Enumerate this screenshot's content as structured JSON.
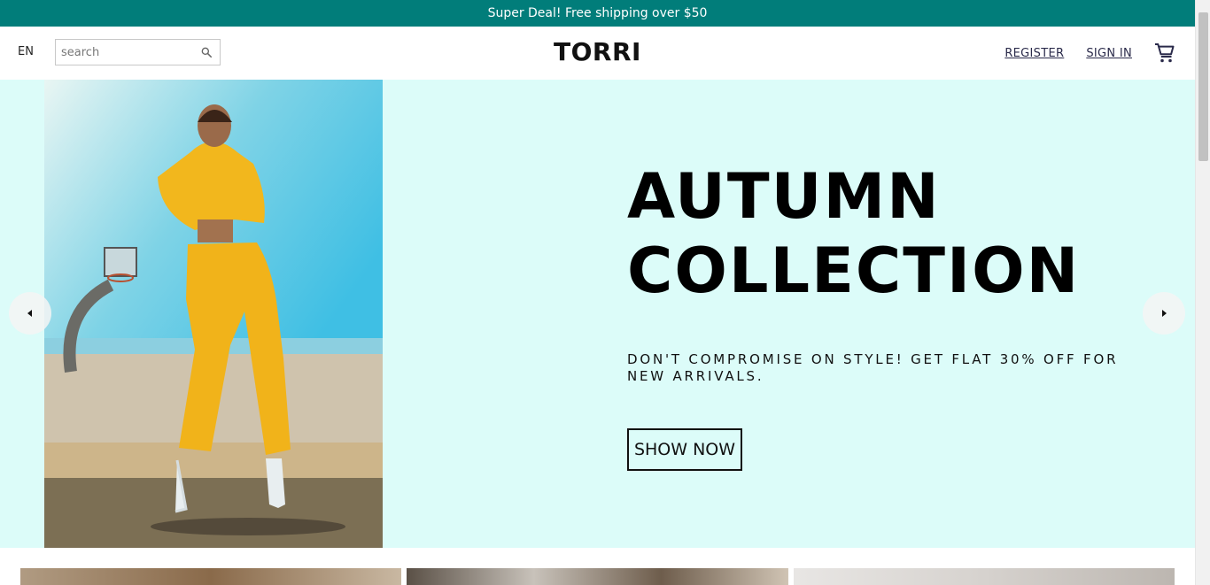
{
  "announcement": "Super Deal! Free shipping over $50",
  "nav": {
    "language": "EN",
    "search_placeholder": "search",
    "logo": "TORRI",
    "register": "REGISTER",
    "sign_in": "SIGN IN"
  },
  "hero": {
    "headline_line1": "AUTUMN",
    "headline_line2": "COLLECTION",
    "subtext": "DON'T COMPROMISE ON STYLE! GET FLAT 30% OFF FOR NEW ARRIVALS.",
    "cta": "SHOW NOW"
  },
  "colors": {
    "accent": "#017d7a",
    "hero_bg": "#dcfcf9"
  },
  "icons": [
    "search-icon",
    "cart-icon",
    "arrow-left-icon",
    "arrow-right-icon"
  ]
}
